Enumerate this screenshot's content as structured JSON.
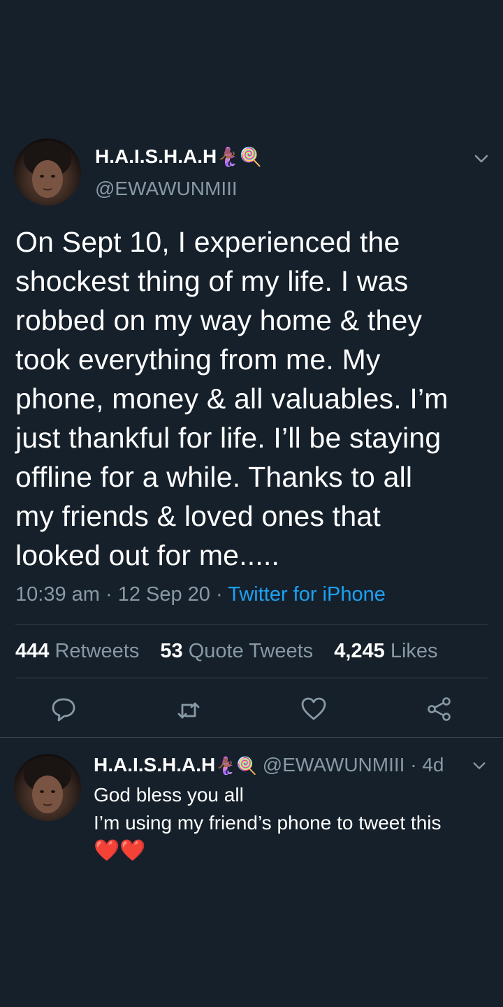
{
  "main_tweet": {
    "display_name": "H.A.I.S.H.A.H",
    "name_emoji": "🧜🏾‍♀️🍭",
    "handle": "@EWAWUNMIII",
    "text_lines": [
      "On Sept 10, I experienced the",
      "shockest thing of my life. I was",
      "robbed on my way home & they",
      "took everything from me. My",
      "phone, money & all valuables. I’m",
      "just thankful for life. I’ll be staying",
      "offline for a while. Thanks to all",
      "my friends & loved ones that",
      "looked out for me....."
    ],
    "time": "10:39 am",
    "date": "12 Sep 20",
    "source": "Twitter for iPhone",
    "retweets_count": "444",
    "retweets_label": "Retweets",
    "quotes_count": "53",
    "quotes_label": "Quote Tweets",
    "likes_count": "4,245",
    "likes_label": "Likes"
  },
  "reply_tweet": {
    "display_name": "H.A.I.S.H.A.H",
    "name_emoji": "🧜🏾‍♀️🍭",
    "handle": "@EWAWUNMIII",
    "age": "4d",
    "line1": "God bless you all",
    "line2": "I’m using my friend’s phone to tweet this",
    "hearts": "❤️❤️"
  },
  "colors": {
    "background": "#15202b",
    "secondary_text": "#8899a6",
    "link": "#1da1f2",
    "divider": "#38444d"
  }
}
